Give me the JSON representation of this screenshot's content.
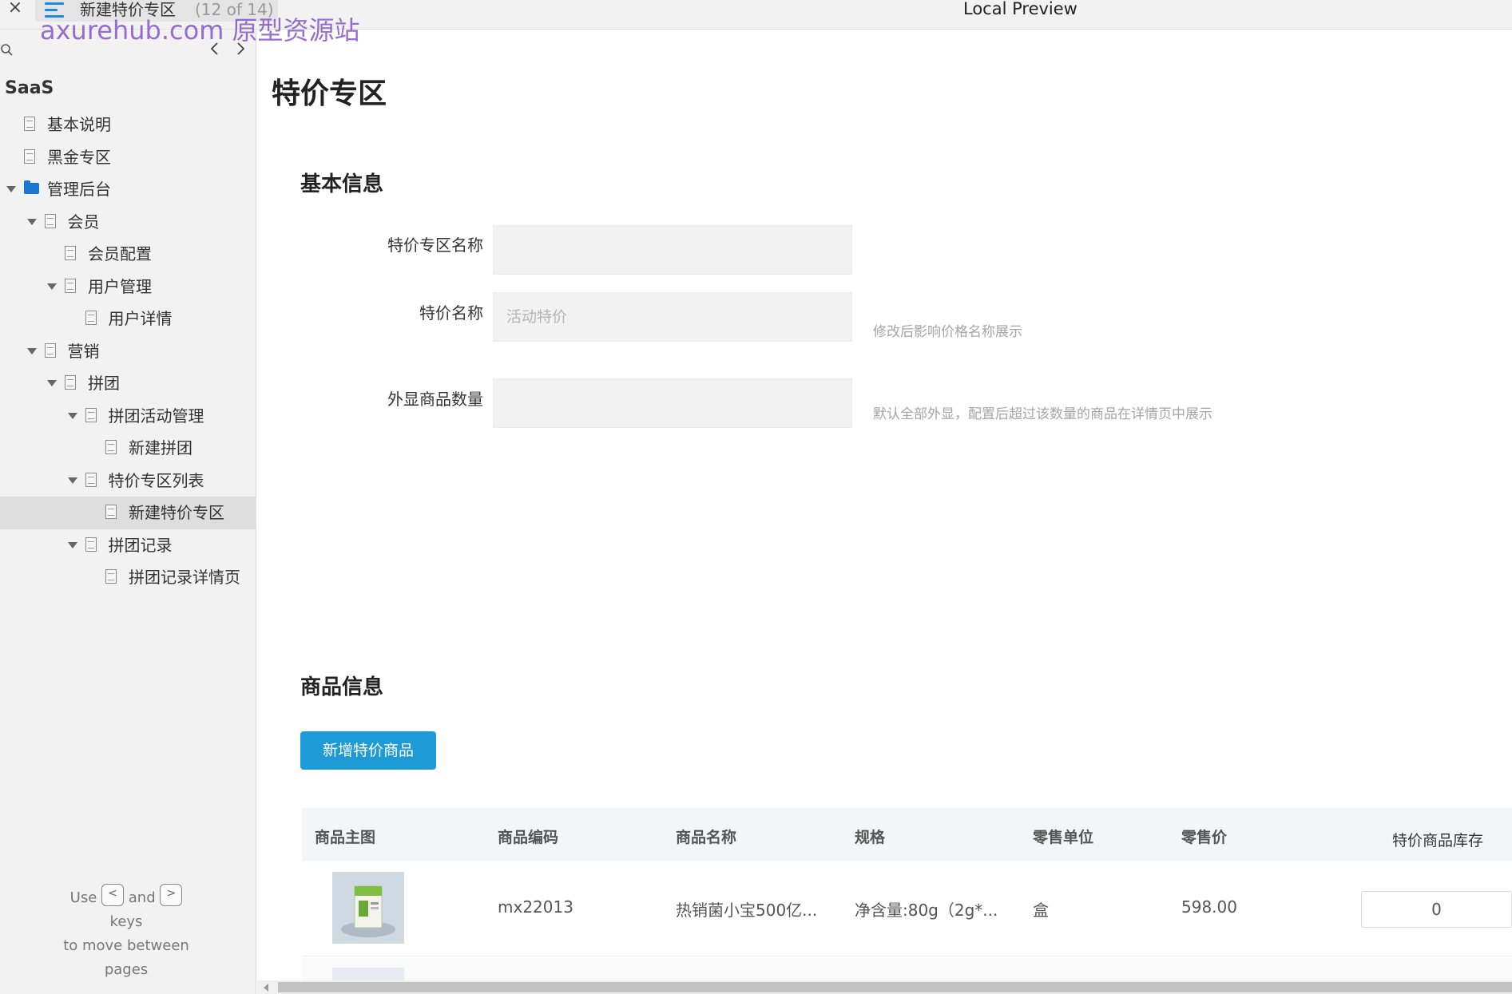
{
  "topbar": {
    "close_glyph": "×",
    "page_name": "新建特价专区",
    "page_count": "(12 of 14)",
    "preview_title": "Local Preview",
    "watermark": "axurehub.com 原型资源站"
  },
  "sidebar": {
    "project_name": "SaaS",
    "prev_glyph": "‹",
    "next_glyph": "›",
    "tree": [
      {
        "label": "基本说明",
        "depth": 0,
        "icon": "page-icon",
        "caret": false
      },
      {
        "label": "黑金专区",
        "depth": 0,
        "icon": "page-icon",
        "caret": false
      },
      {
        "label": "管理后台",
        "depth": 0,
        "icon": "folder-icon",
        "caret": true
      },
      {
        "label": "会员",
        "depth": 1,
        "icon": "page-icon",
        "caret": true
      },
      {
        "label": "会员配置",
        "depth": 2,
        "icon": "page-icon",
        "caret": false
      },
      {
        "label": "用户管理",
        "depth": 2,
        "icon": "page-icon",
        "caret": true
      },
      {
        "label": "用户详情",
        "depth": 3,
        "icon": "page-icon",
        "caret": false
      },
      {
        "label": "营销",
        "depth": 1,
        "icon": "page-icon",
        "caret": true
      },
      {
        "label": "拼团",
        "depth": 2,
        "icon": "page-icon",
        "caret": true
      },
      {
        "label": "拼团活动管理",
        "depth": 3,
        "icon": "page-icon",
        "caret": true
      },
      {
        "label": "新建拼团",
        "depth": 4,
        "icon": "page-icon",
        "caret": false
      },
      {
        "label": "特价专区列表",
        "depth": 3,
        "icon": "page-icon",
        "caret": true
      },
      {
        "label": "新建特价专区",
        "depth": 4,
        "icon": "page-icon",
        "caret": false,
        "selected": true
      },
      {
        "label": "拼团记录",
        "depth": 3,
        "icon": "page-icon",
        "caret": true
      },
      {
        "label": "拼团记录详情页",
        "depth": 4,
        "icon": "page-icon",
        "caret": false
      }
    ],
    "help": {
      "use": "Use",
      "key_prev": "<",
      "and": "and",
      "key_next": ">",
      "keys": "keys",
      "line2": "to move between",
      "line3": "pages"
    }
  },
  "main": {
    "page_title": "特价专区",
    "basic_section": "基本信息",
    "fields": {
      "zone_name": {
        "label": "特价专区名称",
        "value": ""
      },
      "price_name": {
        "label": "特价名称",
        "placeholder": "活动特价",
        "hint": "修改后影响价格名称展示"
      },
      "display_count": {
        "label": "外显商品数量",
        "value": "",
        "hint": "默认全部外显，配置后超过该数量的商品在详情页中展示"
      }
    },
    "goods_section": "商品信息",
    "add_button": "新增特价商品",
    "table": {
      "headers": [
        "商品主图",
        "商品编码",
        "商品名称",
        "规格",
        "零售单位",
        "零售价",
        "特价商品库存"
      ],
      "rows": [
        {
          "code": "mx22013",
          "name": "热销菌小宝500亿...",
          "spec": "净含量:80g（2g*...",
          "unit": "盒",
          "price": "598.00",
          "stock": "0"
        }
      ]
    }
  },
  "colors": {
    "accent": "#1e9ad6",
    "sidebar_bg": "#f2f2f2",
    "watermark": "#804ec8",
    "folder": "#1976d2"
  }
}
